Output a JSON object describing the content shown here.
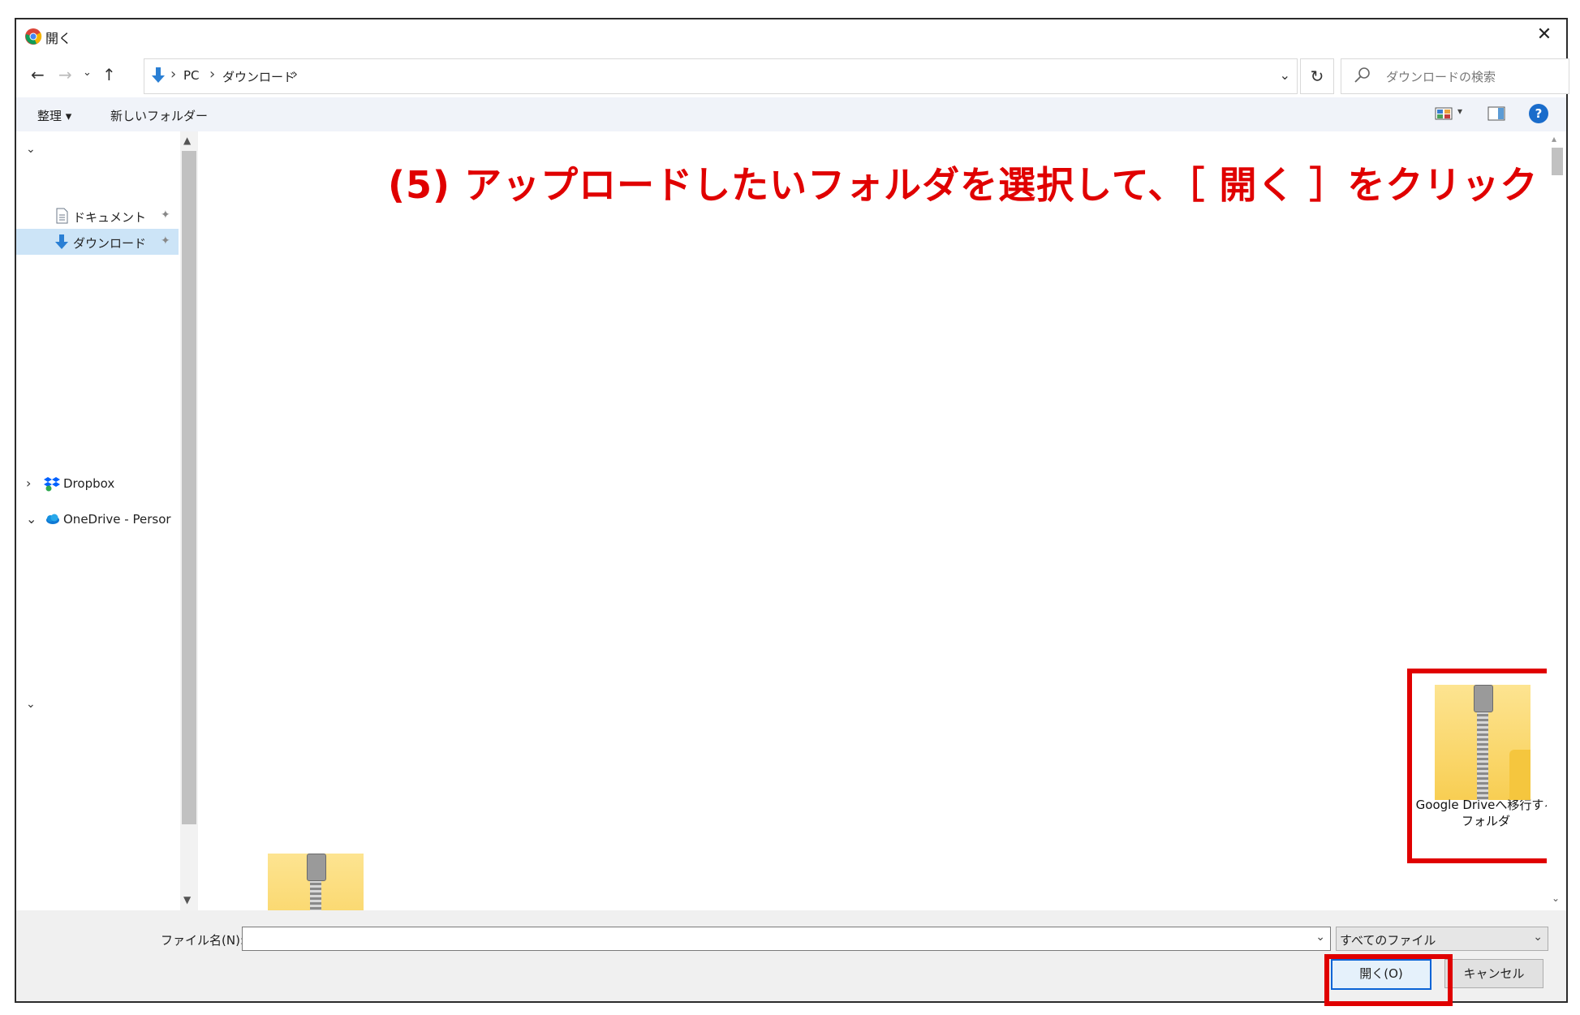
{
  "window": {
    "title": "開く"
  },
  "address": {
    "crumbs": [
      "PC",
      "ダウンロード"
    ],
    "search_placeholder": "ダウンロードの検索"
  },
  "commandbar": {
    "organize": "整理",
    "new_folder": "新しいフォルダー"
  },
  "navpane": {
    "items": [
      {
        "label": "ドキュメント"
      },
      {
        "label": "ダウンロード"
      },
      {
        "label": "Dropbox"
      },
      {
        "label": "OneDrive - Persor"
      }
    ]
  },
  "content": {
    "instruction": "(5) アップロードしたいフォルダを選択して、［ 開く ］をクリック",
    "selected_item": {
      "line1": "Google Driveへ移行する",
      "line2": "フォルダ"
    }
  },
  "bottom": {
    "filename_label": "ファイル名(N):",
    "filename_value": "",
    "filetype": "すべてのファイル",
    "open": "開く(O)",
    "cancel": "キャンセル"
  },
  "colors": {
    "highlight": "#e00000",
    "selection": "#cce4f7",
    "folder": "#fbd96f",
    "accent": "#0a64d6"
  }
}
